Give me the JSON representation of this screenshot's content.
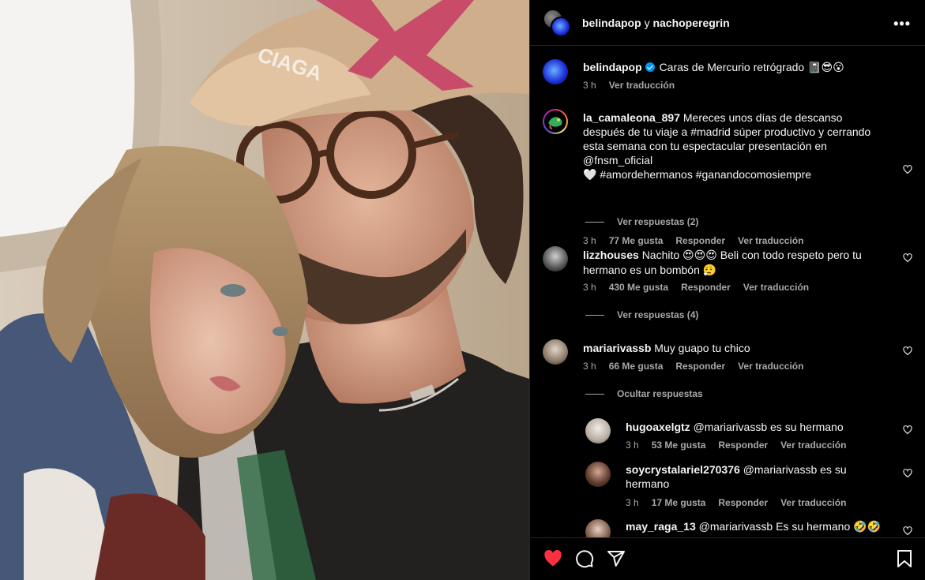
{
  "header": {
    "user1": "belindapop",
    "conj": "y",
    "user2": "nachoperegrin",
    "more_label": "•••"
  },
  "caption": {
    "username": "belindapop",
    "text": "Caras de Mercurio retrógrado",
    "emoji": "📓😎😮",
    "time": "3 h",
    "translate": "Ver traducción"
  },
  "comments": [
    {
      "username": "la_camaleona_897",
      "text_lines": [
        "Mereces unos días de descanso",
        "después de tu viaje a #madrid súper productivo y cerrando",
        "esta semana con tu espectacular presentación en",
        "@fnsm_oficial",
        "🤍 #amordehermanos #ganandocomosiempre"
      ],
      "line1_rest": "Mereces unos días de descanso",
      "line2": "después de tu viaje a #madrid súper productivo y cerrando",
      "line3": "esta semana con tu espectacular presentación en",
      "line4": "@fnsm_oficial",
      "line5": "#amordehermanos #ganandocomosiempre",
      "line5_emoji": "🤍",
      "time": "3 h",
      "likes": "77 Me gusta",
      "reply": "Responder",
      "translate": "Ver traducción",
      "replies_label": "Ver respuestas (2)"
    },
    {
      "username": "lizzhouses",
      "line1_rest": "Nachito",
      "line1_emoji": "😍😍😍",
      "line1_after": "Beli con todo respeto pero tu",
      "line2": "hermano es un bombón",
      "line2_emoji": "😮‍💨",
      "time": "3 h",
      "likes": "430 Me gusta",
      "reply": "Responder",
      "translate": "Ver traducción",
      "replies_label": "Ver respuestas (4)"
    },
    {
      "username": "mariarivassb",
      "line1_rest": "Muy guapo tu chico",
      "time": "3 h",
      "likes": "66 Me gusta",
      "reply": "Responder",
      "translate": "Ver traducción",
      "replies_label": "Ocultar respuestas"
    }
  ],
  "replies": [
    {
      "username": "hugoaxelgtz",
      "line1_rest": "@mariarivassb es su hermano",
      "time": "3 h",
      "likes": "53 Me gusta",
      "reply": "Responder",
      "translate": "Ver traducción"
    },
    {
      "username": "soycrystalariel270376",
      "line1_rest": "@mariarivassb es su",
      "line2": "hermano",
      "time": "3 h",
      "likes": "17 Me gusta",
      "reply": "Responder",
      "translate": "Ver traducción"
    },
    {
      "username": "may_raga_13",
      "line1_rest": "@mariarivassb Es su hermano",
      "line1_emoji": "🤣🤣"
    }
  ],
  "actions": {
    "liked": true,
    "like_color": "#ff3040"
  }
}
